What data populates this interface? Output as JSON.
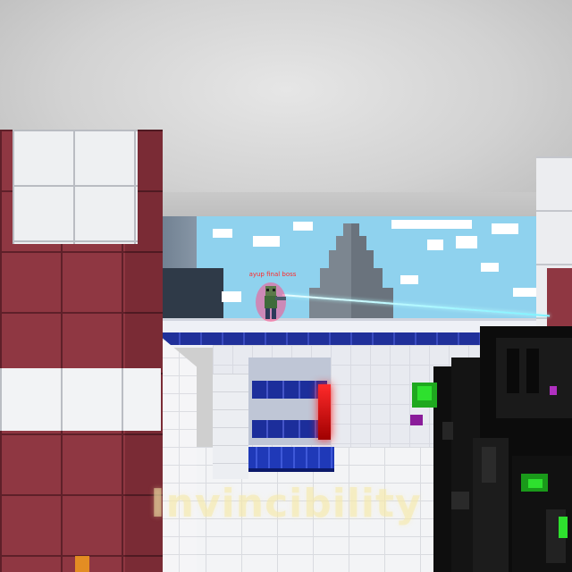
{
  "game": {
    "enemy_nametag": "ayup final boss",
    "status_effect": "Invincibility"
  },
  "colors": {
    "sky": "#8fd2ee",
    "pillar_red": "#8f3742",
    "floor_white": "#f3f4f6",
    "stripe_blue": "#20309a",
    "nametag_red": "#ff2a2a",
    "laser_cyan": "#7ef3ff",
    "overlay_text": "#f4e8aa",
    "gun_accent_green": "#2ee02e",
    "gun_accent_purple": "#b030c0",
    "hud_orange": "#f7a21b"
  },
  "icons": [
    "crosshair-hidden",
    "weapon-model"
  ]
}
